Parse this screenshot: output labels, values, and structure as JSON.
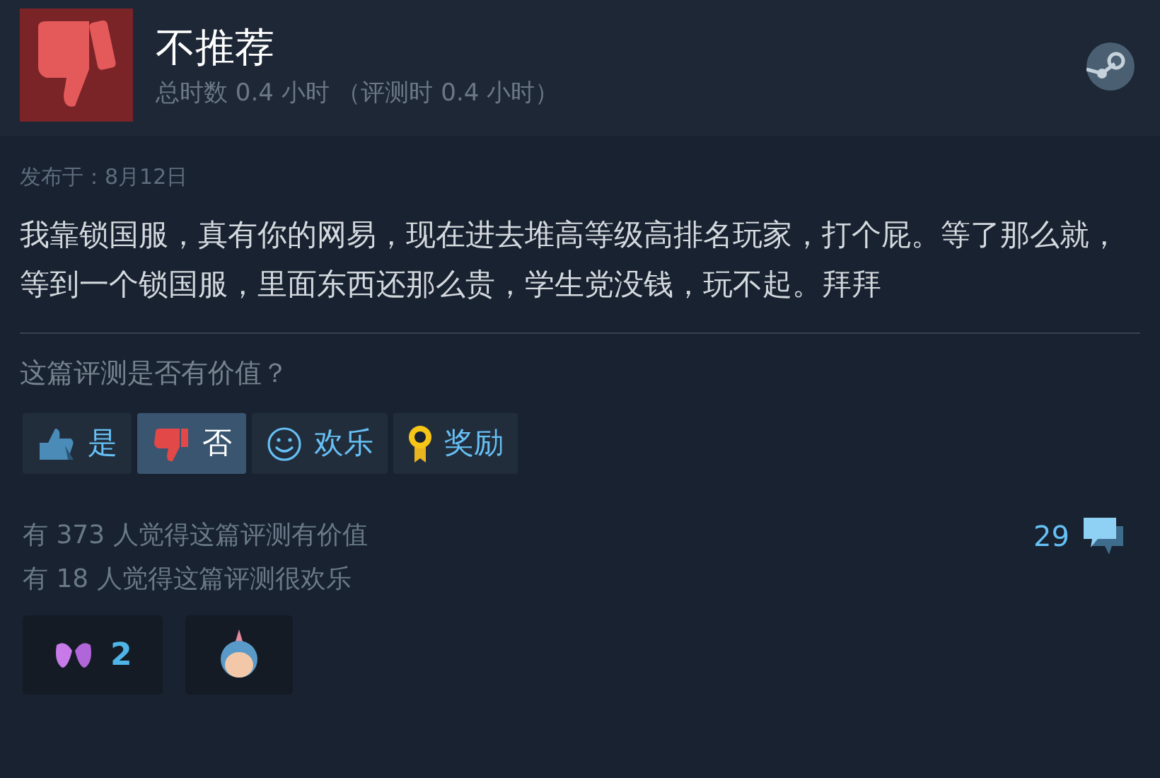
{
  "header": {
    "verdict": "不推荐",
    "recommended": false,
    "playtime": "总时数 0.4 小时 （评测时 0.4 小时）"
  },
  "posted": "发布于：8月12日",
  "review_text": "我靠锁国服，真有你的网易，现在进去堆高等级高排名玩家，打个屁。等了那么就，等到一个锁国服，里面东西还那么贵，学生党没钱，玩不起。拜拜",
  "helpful_question": "这篇评测是否有价值？",
  "buttons": [
    {
      "kind": "yes",
      "label": "是",
      "selected": false
    },
    {
      "kind": "no",
      "label": "否",
      "selected": true
    },
    {
      "kind": "funny",
      "label": "欢乐",
      "selected": false
    },
    {
      "kind": "award",
      "label": "奖励",
      "selected": false
    }
  ],
  "stats": [
    "有 373 人觉得这篇评测有价值",
    "有 18 人觉得这篇评测很欢乐"
  ],
  "comments": {
    "count": "29"
  },
  "awards": [
    {
      "kind": "hearts",
      "count": "2"
    },
    {
      "kind": "character"
    }
  ]
}
